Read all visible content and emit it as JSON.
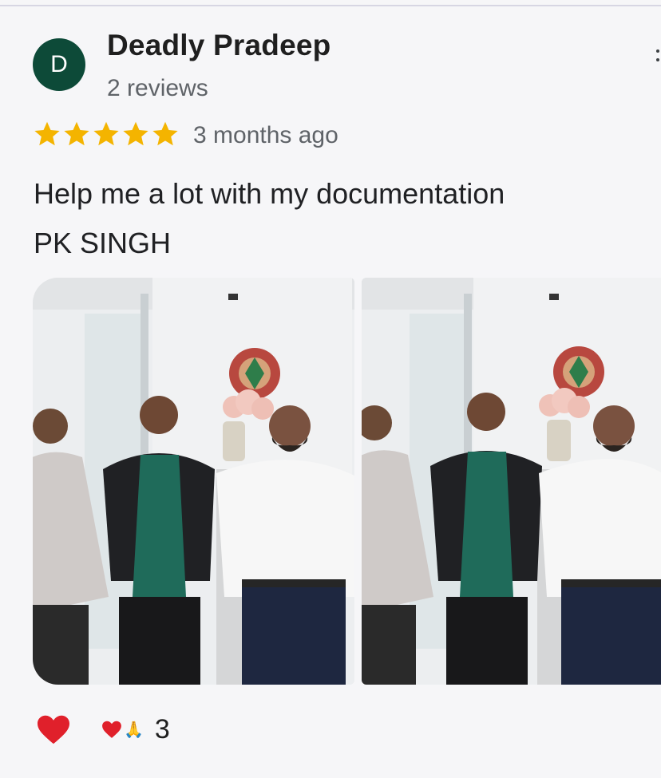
{
  "review": {
    "avatar_letter": "D",
    "author": "Deadly Pradeep",
    "reviews": "2 reviews",
    "rating": 5,
    "time": "3 months ago",
    "lines": [
      "Help me a lot with my documentation",
      "PK SINGH"
    ]
  },
  "photos": [
    {
      "icon": "group-photo"
    },
    {
      "icon": "group-photo"
    }
  ],
  "reactions": {
    "like_icon": "heart-icon",
    "summary_icons": [
      "heart",
      "folded-hands"
    ],
    "pray_glyph": "🙏",
    "count": "3"
  },
  "colors": {
    "avatar_bg": "#0d4a38",
    "star": "#f4b400",
    "heart": "#e0202b",
    "secondary_text": "#5f6368"
  }
}
